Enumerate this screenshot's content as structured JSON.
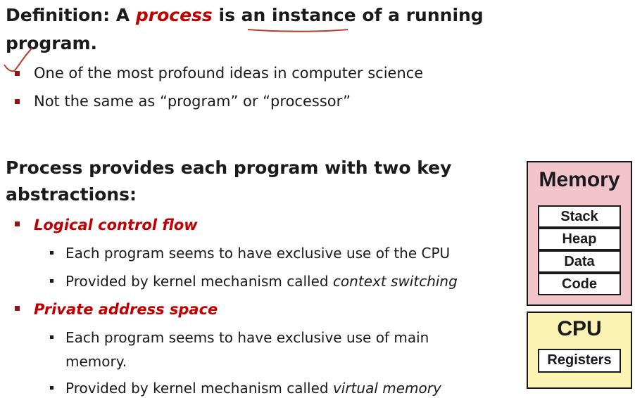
{
  "definition": {
    "prefix": "Definition: A ",
    "term": "process",
    "middle": " is an ",
    "underlined": "instance",
    "suffix": " of a running",
    "line2": "program."
  },
  "def_bullets": [
    "One of the most profound ideas in computer science",
    "Not the same as “program” or “processor”"
  ],
  "abstractions": {
    "heading_line1": "Process provides each program with two key",
    "heading_line2": "abstractions:",
    "items": [
      {
        "title": "Logical control flow",
        "sub1": "Each program seems to have exclusive use of the CPU",
        "sub2_prefix": "Provided by kernel mechanism called ",
        "sub2_italic": "context switching"
      },
      {
        "title": "Private address space",
        "sub1_line1": "Each program seems to have exclusive use of main",
        "sub1_line2": "memory.",
        "sub2_prefix": "Provided by kernel mechanism called ",
        "sub2_italic": "virtual memory"
      }
    ]
  },
  "diagram": {
    "memory": {
      "title": "Memory",
      "cells": [
        "Stack",
        "Heap",
        "Data",
        "Code"
      ],
      "color": "#f2c4cc"
    },
    "cpu": {
      "title": "CPU",
      "cells": [
        "Registers"
      ],
      "color": "#fbf3b4"
    }
  },
  "colors": {
    "accent_red": "#c00000",
    "bullet_red": "#9b1111",
    "annotation_red": "#c0392b"
  }
}
